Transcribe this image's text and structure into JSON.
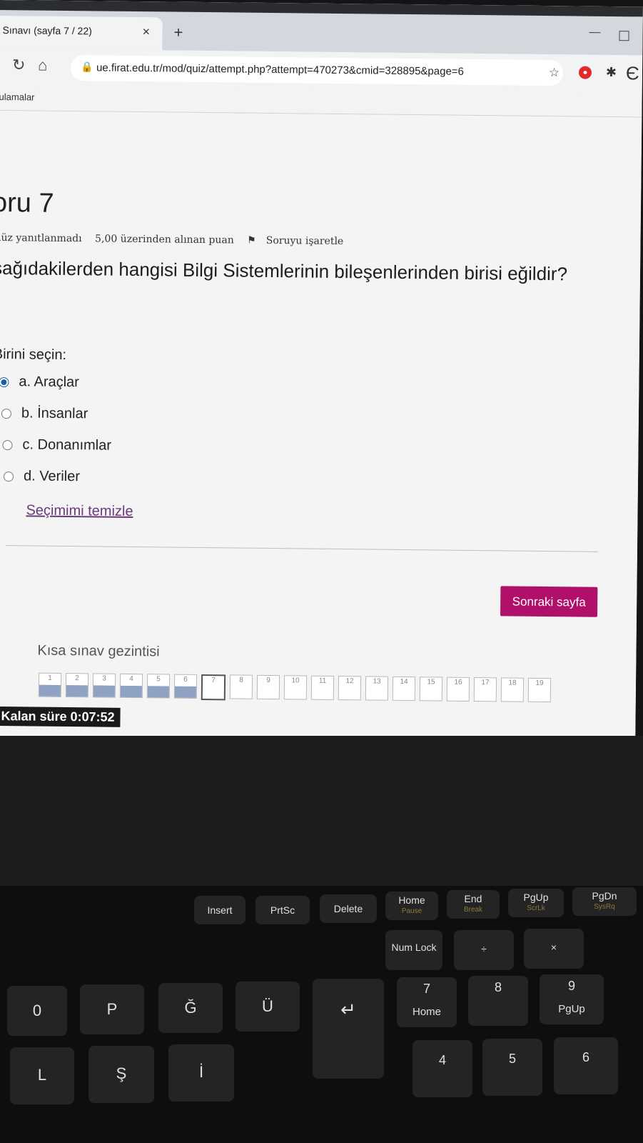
{
  "browser": {
    "tab_title": "Sınavı (sayfa 7 / 22)",
    "tab_close": "×",
    "new_tab": "+",
    "url": "ue.firat.edu.tr/mod/quiz/attempt.php?attempt=470273&cmid=328895&page=6",
    "bookmark": "ulamalar",
    "icons": {
      "reload": "reload-icon",
      "home": "home-icon",
      "lock": "lock-icon",
      "star": "star-icon"
    }
  },
  "question": {
    "title": "oru 7",
    "status": "nüz yanıtlanmadı",
    "points": "5,00 üzerinden alınan puan",
    "flag": "Soruyu işaretle",
    "text": "şağıdakilerden hangisi Bilgi Sistemlerinin bileşenlerinden birisi eğildir?",
    "prompt": "Birini seçin:",
    "options": [
      {
        "label": "a. Araçlar",
        "selected": true
      },
      {
        "label": "b. İnsanlar",
        "selected": false
      },
      {
        "label": "c. Donanımlar",
        "selected": false
      },
      {
        "label": "d. Veriler",
        "selected": false
      }
    ],
    "clear": "Seçimimi temizle"
  },
  "next_button": "Sonraki sayfa",
  "navigation": {
    "title": "Kısa sınav gezintisi",
    "buttons": [
      {
        "n": "1",
        "state": "answered"
      },
      {
        "n": "2",
        "state": "answered"
      },
      {
        "n": "3",
        "state": "answered"
      },
      {
        "n": "4",
        "state": "answered"
      },
      {
        "n": "5",
        "state": "answered"
      },
      {
        "n": "6",
        "state": "answered"
      },
      {
        "n": "7",
        "state": "current"
      },
      {
        "n": "8",
        "state": ""
      },
      {
        "n": "9",
        "state": ""
      },
      {
        "n": "10",
        "state": ""
      },
      {
        "n": "11",
        "state": ""
      },
      {
        "n": "12",
        "state": ""
      },
      {
        "n": "13",
        "state": ""
      },
      {
        "n": "14",
        "state": ""
      },
      {
        "n": "15",
        "state": ""
      },
      {
        "n": "16",
        "state": ""
      },
      {
        "n": "17",
        "state": ""
      },
      {
        "n": "18",
        "state": ""
      },
      {
        "n": "19",
        "state": ""
      }
    ]
  },
  "timer": "Kalan süre 0:07:52",
  "keyboard": {
    "fn_row": [
      "Insert",
      "PrtSc",
      "Delete",
      "Home",
      "End",
      "PgUp",
      "PgDn"
    ],
    "fn_sub": [
      "Pause",
      "Break",
      "ScrLk",
      "SysRq"
    ],
    "num_lock": "Num Lock",
    "keys": [
      "0",
      "P",
      "Ğ",
      "Ü",
      "7",
      "8",
      "9",
      "Home",
      "PgUp",
      "L",
      "Ş",
      "İ",
      "4",
      "5",
      "6",
      "÷",
      "×"
    ]
  }
}
